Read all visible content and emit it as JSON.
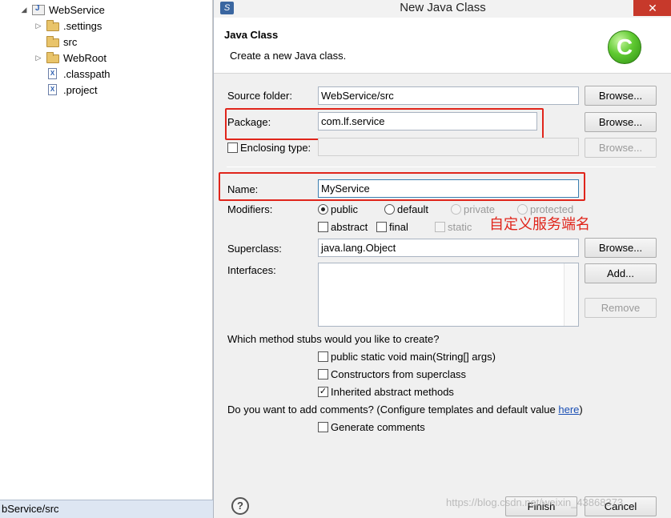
{
  "explorer": {
    "project": "WebService",
    "items": [
      {
        "label": ".settings",
        "type": "folder"
      },
      {
        "label": "src",
        "type": "folder"
      },
      {
        "label": "WebRoot",
        "type": "folder"
      },
      {
        "label": ".classpath",
        "type": "file"
      },
      {
        "label": ".project",
        "type": "file"
      }
    ]
  },
  "statusbar": {
    "text": "bService/src"
  },
  "dialog": {
    "title": "New Java Class",
    "close_label": "✕",
    "header": {
      "title": "Java Class",
      "description": "Create a new Java class.",
      "logo": "C"
    },
    "source_folder": {
      "label": "Source folder:",
      "value": "WebService/src",
      "browse": "Browse..."
    },
    "package": {
      "label": "Package:",
      "value": "com.lf.service",
      "browse": "Browse..."
    },
    "enclosing": {
      "label": "Enclosing type:",
      "value": "",
      "browse": "Browse..."
    },
    "name": {
      "label": "Name:",
      "value": "MyService"
    },
    "modifiers": {
      "label": "Modifiers:",
      "public": "public",
      "default": "default",
      "private": "private",
      "protected": "protected",
      "abstract": "abstract",
      "final": "final",
      "static": "static"
    },
    "superclass": {
      "label": "Superclass:",
      "value": "java.lang.Object",
      "browse": "Browse..."
    },
    "interfaces": {
      "label": "Interfaces:",
      "add": "Add...",
      "remove": "Remove"
    },
    "stubs": {
      "question": "Which method stubs would you like to create?",
      "main": "public static void main(String[] args)",
      "constructors": "Constructors from superclass",
      "inherited": "Inherited abstract methods"
    },
    "comments": {
      "question": "Do you want to add comments? (Configure templates and default value ",
      "link": "here",
      "close_paren": ")",
      "generate": "Generate comments"
    },
    "help": "?",
    "finish": "Finish",
    "cancel": "Cancel"
  },
  "annotation": "自定义服务端名",
  "watermark": "https://blog.csdn.net/weixin_43868373",
  "colors": {
    "annotation": "#e0251b",
    "accent": "#3c7fb1"
  }
}
